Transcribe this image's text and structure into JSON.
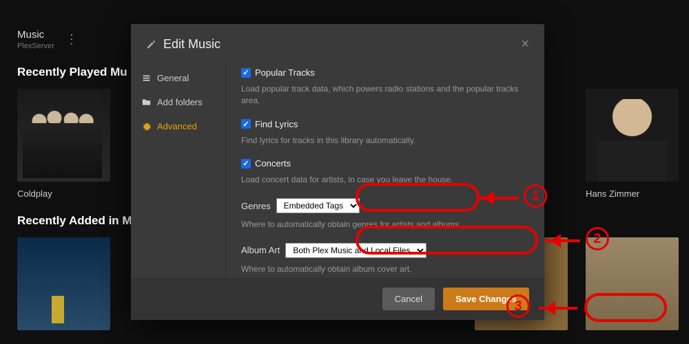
{
  "header": {
    "title": "Music",
    "subtitle": "PlexServer"
  },
  "sections": {
    "recent_played": "Recently Played Mu",
    "recent_added": "Recently Added in M"
  },
  "tiles": {
    "coldplay": "Coldplay",
    "hans": "Hans Zimmer"
  },
  "modal": {
    "title": "Edit Music",
    "side": {
      "general": "General",
      "folders": "Add folders",
      "advanced": "Advanced"
    },
    "popular": {
      "label": "Popular Tracks",
      "desc": "Load popular track data, which powers radio stations and the popular tracks area."
    },
    "lyrics": {
      "label": "Find Lyrics",
      "desc": "Find lyrics for tracks in this library automatically."
    },
    "concerts": {
      "label": "Concerts",
      "desc": "Load concert data for artists, in case you leave the house."
    },
    "genres": {
      "label": "Genres",
      "value": "Embedded Tags",
      "desc": "Where to automatically obtain genres for artists and albums."
    },
    "albumart": {
      "label": "Album Art",
      "value": "Both Plex Music and Local Files",
      "desc": "Where to automatically obtain album cover art."
    },
    "cancel": "Cancel",
    "save": "Save Changes"
  },
  "annotations": {
    "n1": "1",
    "n2": "2",
    "n3": "3"
  }
}
